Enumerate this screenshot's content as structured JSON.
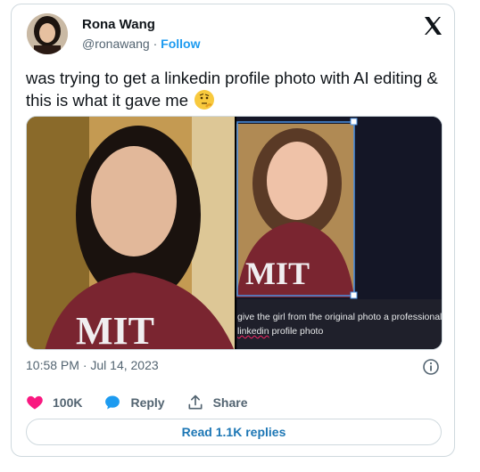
{
  "author": {
    "name": "Rona Wang",
    "handle": "@ronawang",
    "separator": "·",
    "follow_label": "Follow"
  },
  "tweet": {
    "text": "was trying to get a linkedin profile photo with AI editing & this is what it gave me"
  },
  "media": {
    "prompt_line1": "give the girl from the original photo a professional",
    "prompt_line2_word": "linkedin",
    "prompt_line2_rest": " profile photo"
  },
  "meta": {
    "timestamp": "10:58 PM · Jul 14, 2023"
  },
  "actions": {
    "likes": "100K",
    "reply_label": "Reply",
    "share_label": "Share"
  },
  "read_replies_label": "Read 1.1K replies",
  "icons": [
    "x-logo-icon",
    "heart-icon",
    "reply-icon",
    "share-icon",
    "info-icon",
    "thinking-face-emoji"
  ],
  "colors": {
    "accent": "#1d9bf0",
    "like": "#f91880",
    "muted": "#536471"
  }
}
